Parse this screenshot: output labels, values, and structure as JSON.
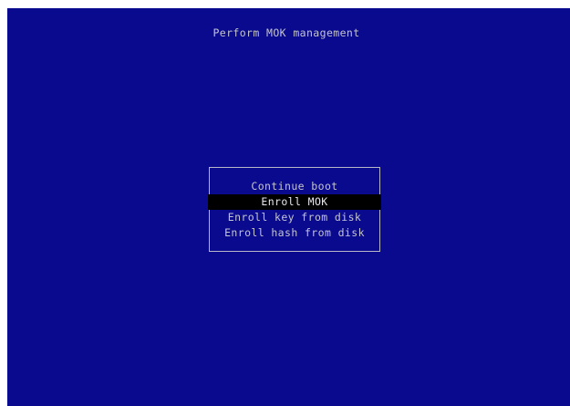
{
  "screen": {
    "title": "Perform MOK management",
    "background_color": "#0a0a8e",
    "selection_color": "#000000"
  },
  "menu": {
    "items": [
      {
        "label": "Continue boot",
        "selected": false
      },
      {
        "label": "Enroll MOK",
        "selected": true
      },
      {
        "label": "Enroll key from disk",
        "selected": false
      },
      {
        "label": "Enroll hash from disk",
        "selected": false
      }
    ]
  }
}
